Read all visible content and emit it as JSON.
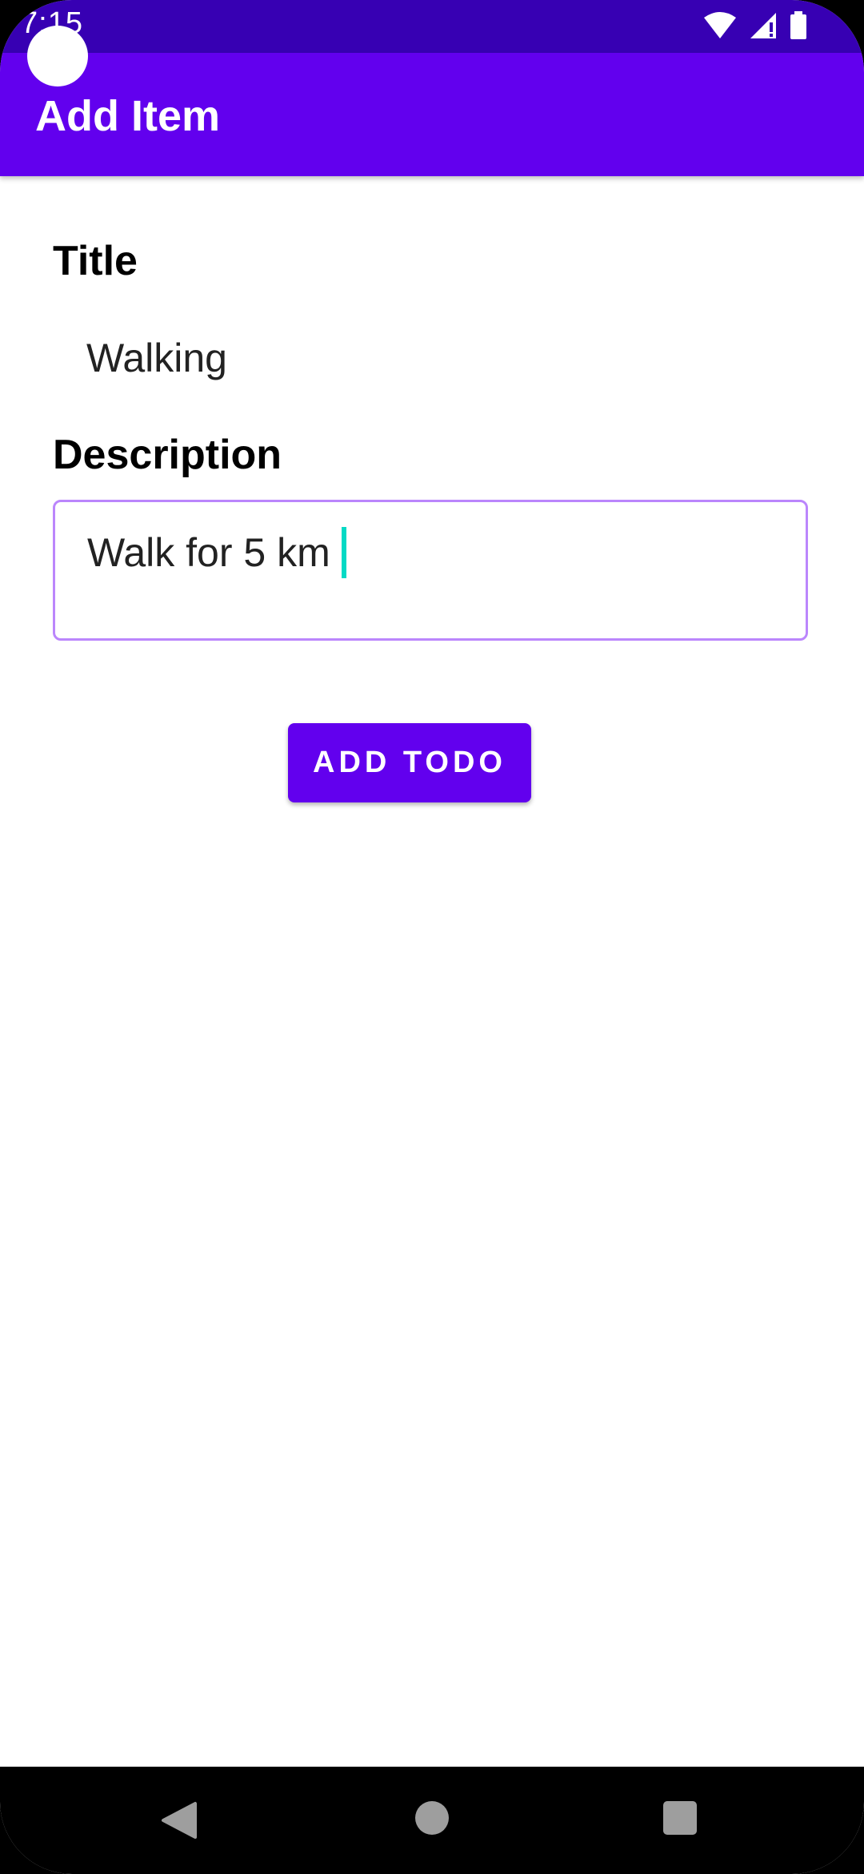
{
  "status_bar": {
    "time": "7:15",
    "icons": [
      "wifi-icon",
      "signal-icon",
      "battery-icon"
    ]
  },
  "app_bar": {
    "title": "Add Item"
  },
  "form": {
    "title_label": "Title",
    "title_value": "Walking",
    "description_label": "Description",
    "description_value": "Walk for 5 km",
    "submit_label": "ADD TODO"
  },
  "nav_bar": {
    "icons": [
      "back-icon",
      "home-icon",
      "recents-icon"
    ]
  },
  "colors": {
    "primary": "#6200EE",
    "primary_dark": "#3700B3",
    "outline": "#BB86FC",
    "cursor": "#03DAC5"
  }
}
